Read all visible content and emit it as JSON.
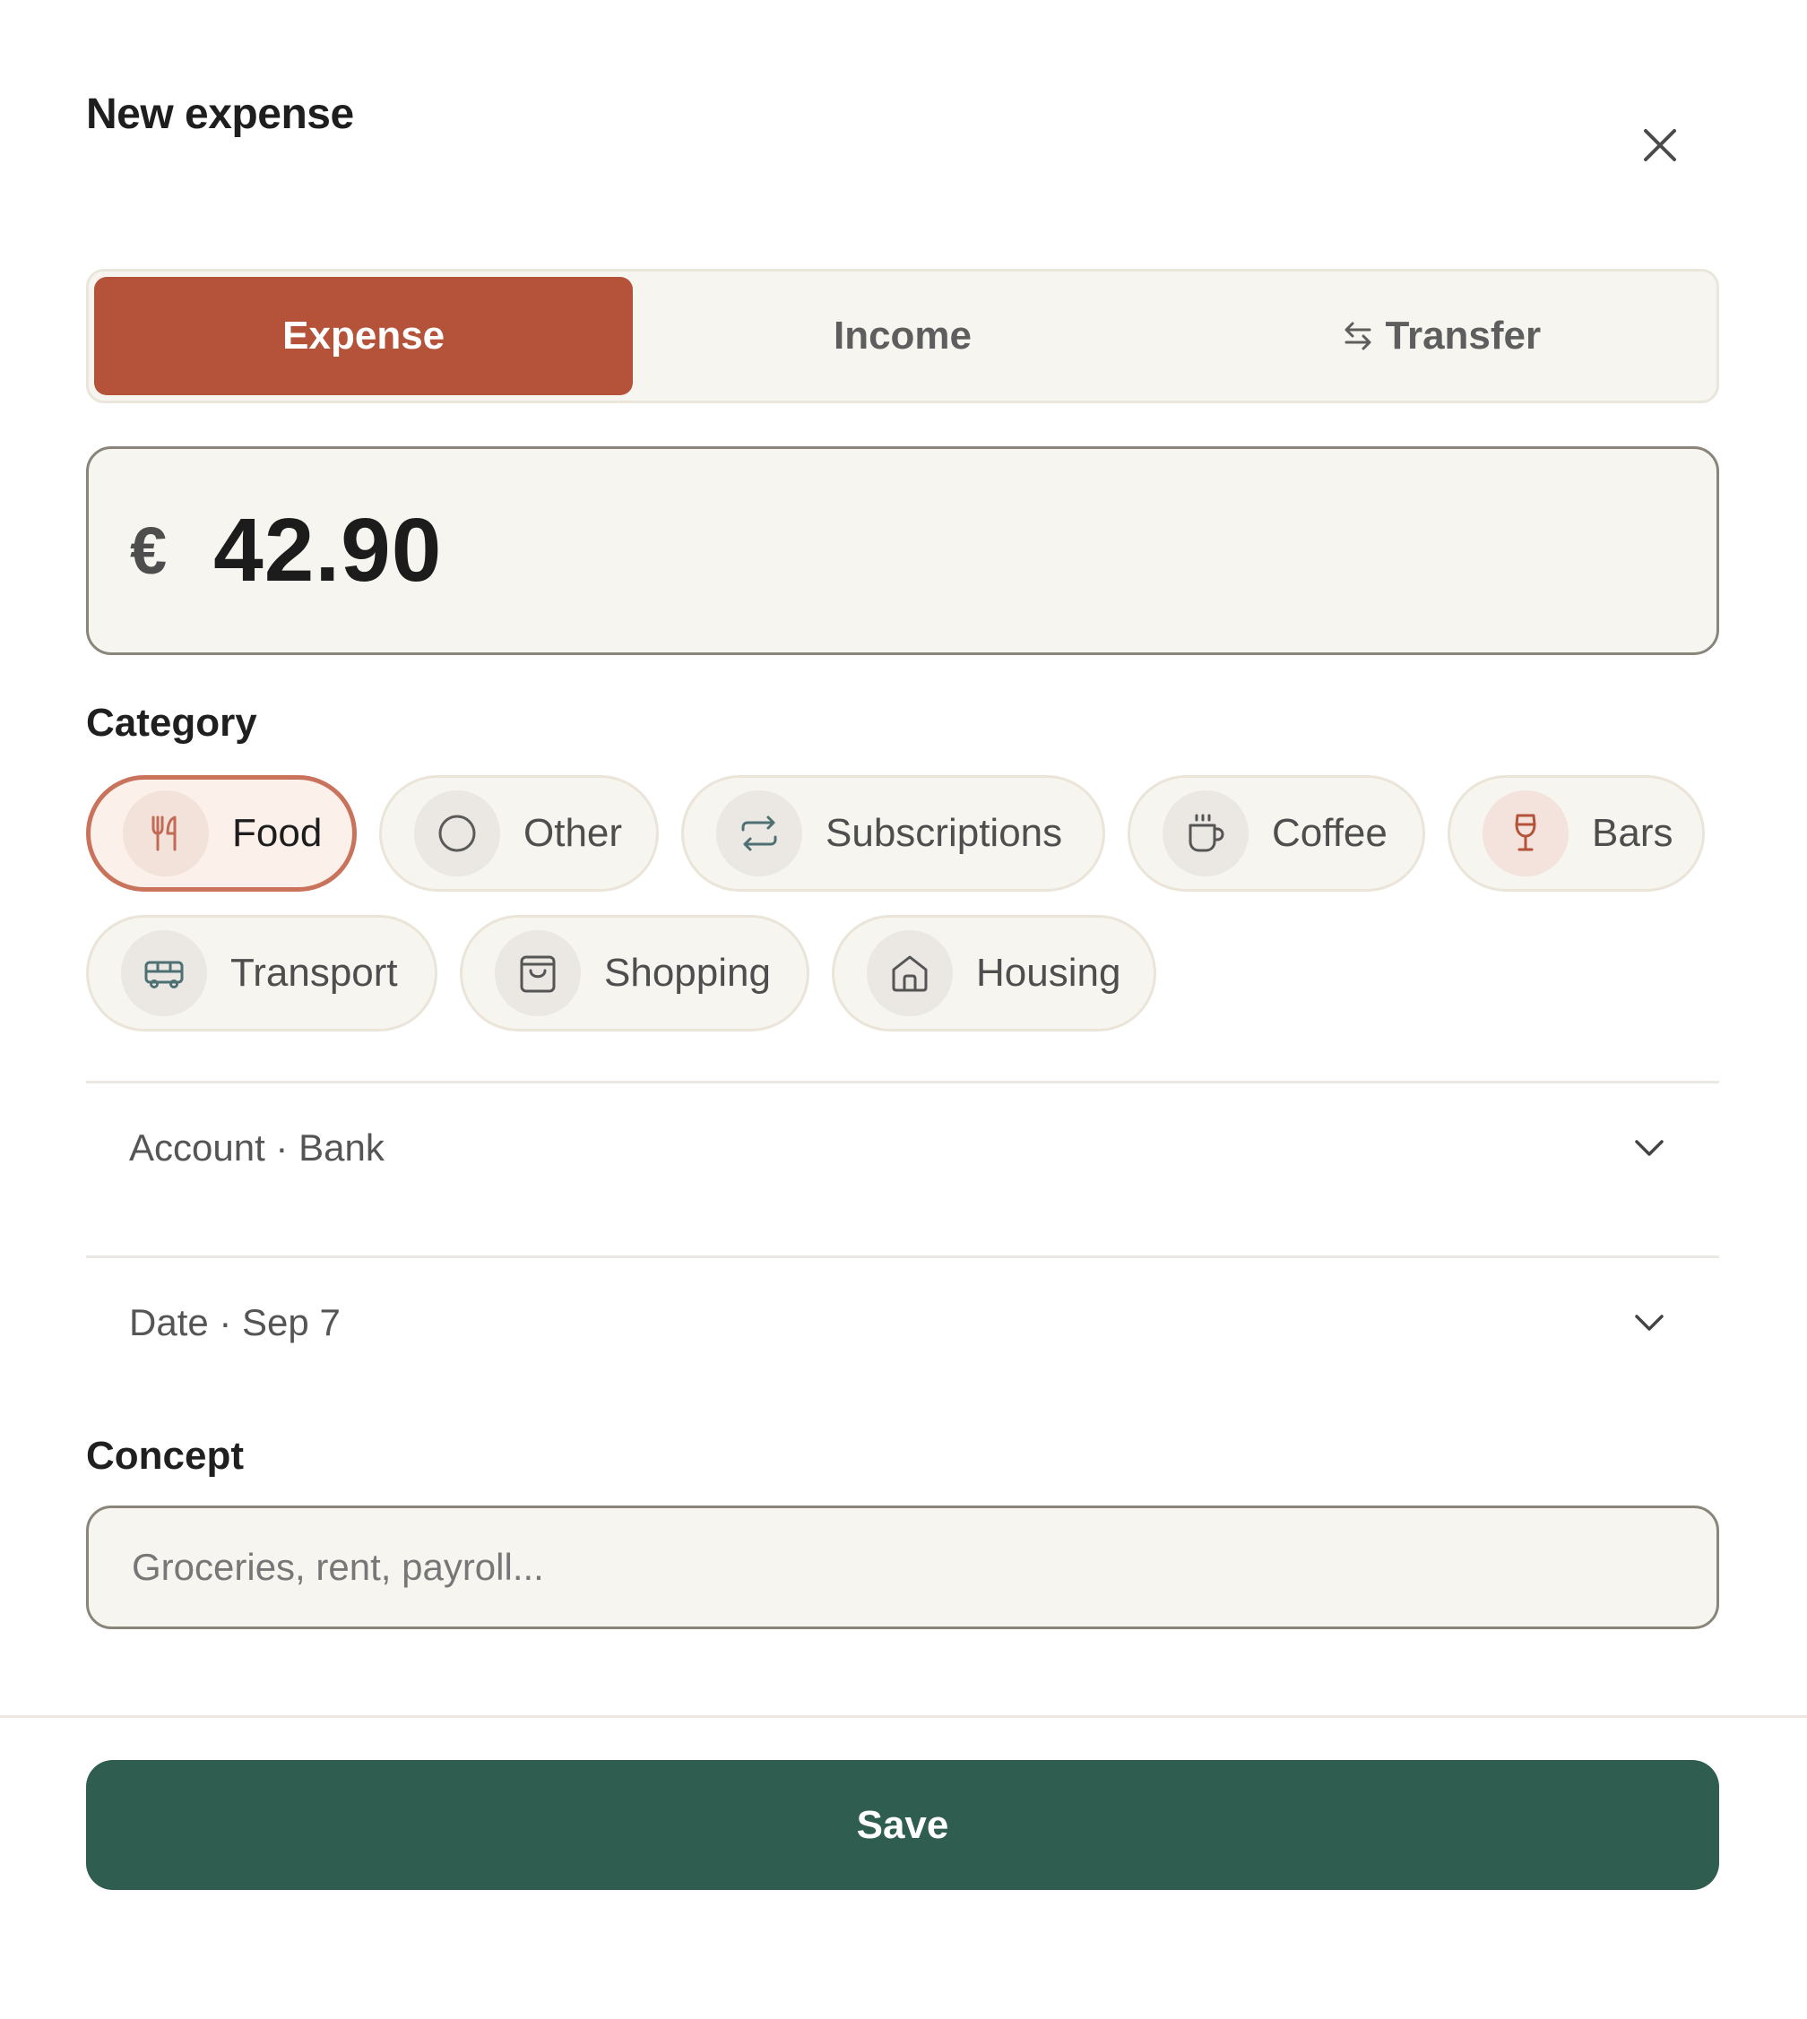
{
  "header": {
    "title": "New expense",
    "close_icon": "close-icon"
  },
  "type_tabs": [
    {
      "label": "Expense",
      "active": true
    },
    {
      "label": "Income",
      "active": false
    },
    {
      "label": "Transfer",
      "active": false,
      "icon": "transfer-arrows-icon"
    }
  ],
  "amount": {
    "currency": "€",
    "value": "42.90"
  },
  "category": {
    "label": "Category",
    "items": [
      {
        "label": "Food",
        "icon": "fork-knife-icon",
        "selected": true
      },
      {
        "label": "Other",
        "icon": "circle-icon",
        "selected": false
      },
      {
        "label": "Subscriptions",
        "icon": "repeat-icon",
        "selected": false
      },
      {
        "label": "Coffee",
        "icon": "coffee-cup-icon",
        "selected": false
      },
      {
        "label": "Bars",
        "icon": "wine-glass-icon",
        "selected": false
      },
      {
        "label": "Transport",
        "icon": "bus-icon",
        "selected": false
      },
      {
        "label": "Shopping",
        "icon": "shopping-bag-icon",
        "selected": false
      },
      {
        "label": "Housing",
        "icon": "house-icon",
        "selected": false
      }
    ]
  },
  "account_row": {
    "text": "Account · Bank",
    "icon": "chevron-down-icon"
  },
  "date_row": {
    "text": "Date · Sep 7",
    "icon": "chevron-down-icon"
  },
  "concept": {
    "label": "Concept",
    "value": "",
    "placeholder": "Groceries, rent, payroll..."
  },
  "footer": {
    "save_label": "Save"
  },
  "colors": {
    "accent": "#b4533a",
    "primary_button": "#2f5d50",
    "surface": "#f7f5ef",
    "border": "#ebe4d8",
    "selected_chip_border": "#c9725c"
  }
}
